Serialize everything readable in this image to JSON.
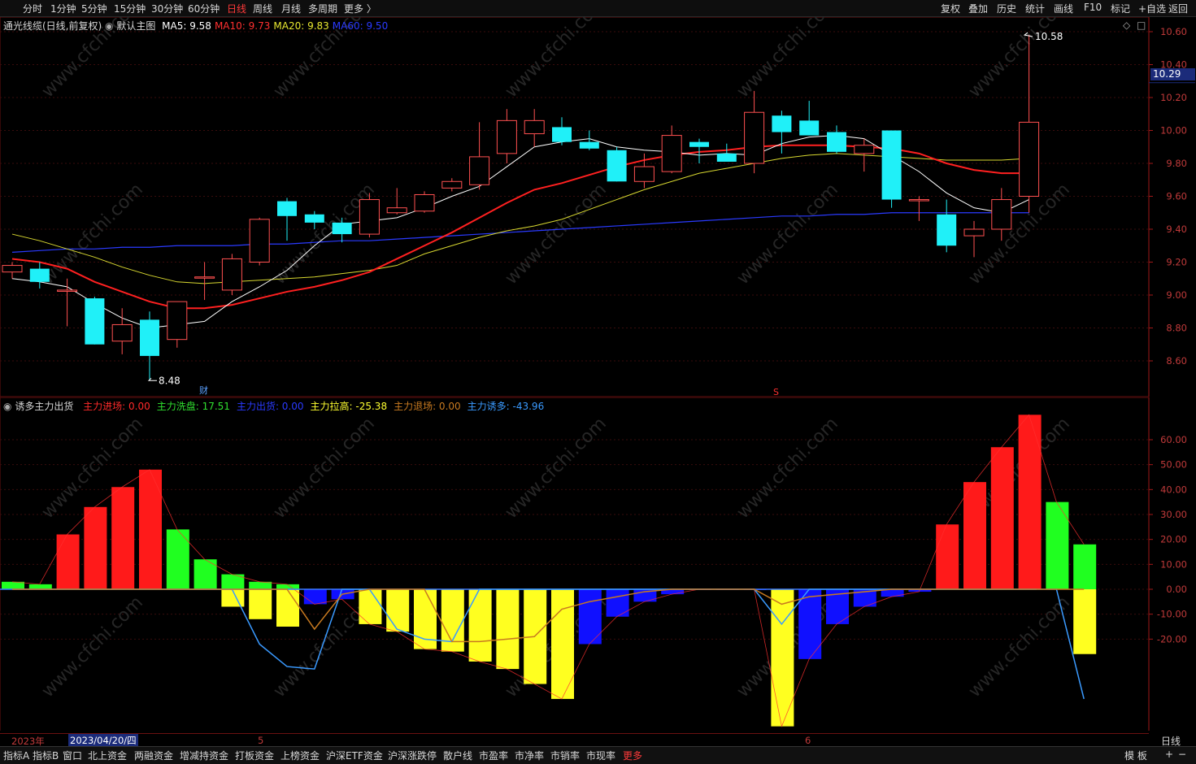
{
  "toolbar": {
    "periods": [
      "分时",
      "1分钟",
      "5分钟",
      "15分钟",
      "30分钟",
      "60分钟",
      "日线",
      "周线",
      "月线",
      "多周期",
      "更多 〉"
    ],
    "active_period": "日线",
    "right_tools": [
      "复权",
      "叠加",
      "历史",
      "统计",
      "画线",
      "F10",
      "标记",
      "+自选",
      "返回"
    ]
  },
  "main": {
    "stock_name": "通光线缆(日线,前复权)",
    "chart_mode": "默认主图",
    "ma": [
      {
        "label": "MA5: 9.58",
        "color": "#ffffff"
      },
      {
        "label": "MA10: 9.73",
        "color": "#ff3030"
      },
      {
        "label": "MA20: 9.83",
        "color": "#e8e830"
      },
      {
        "label": "MA60: 9.50",
        "color": "#2a3aff"
      }
    ],
    "high_label": "10.58",
    "low_label": "8.48",
    "current_price": "10.29",
    "marker_cai": "财",
    "marker_s": "S"
  },
  "indicator": {
    "name": "诱多主力出货",
    "items": [
      {
        "label": "主力进场: 0.00",
        "color": "#ff2a2a"
      },
      {
        "label": "主力洗盘: 17.51",
        "color": "#30e030"
      },
      {
        "label": "主力出货: 0.00",
        "color": "#2a3aff"
      },
      {
        "label": "主力拉高: -25.38",
        "color": "#ffff30"
      },
      {
        "label": "主力退场: 0.00",
        "color": "#c87a20"
      },
      {
        "label": "主力诱多: -43.96",
        "color": "#3a9aff"
      }
    ]
  },
  "price_axis": [
    "10.60",
    "10.40",
    "10.20",
    "10.00",
    "9.80",
    "9.60",
    "9.40",
    "9.20",
    "9.00",
    "8.80",
    "8.60"
  ],
  "ind_axis": [
    "60.00",
    "50.00",
    "40.00",
    "30.00",
    "20.00",
    "10.00",
    "0.00",
    "-10.00",
    "-20.00"
  ],
  "date_axis": {
    "year": "2023年",
    "cursor_date": "2023/04/20/四",
    "months": [
      "5",
      "6"
    ],
    "period": "日线"
  },
  "watermark": "www.cfchi.com",
  "bottom_tabs": [
    "指标A",
    "指标B",
    "窗口",
    "北上资金",
    "两融资金",
    "增减持资金",
    "打板资金",
    "上榜资金",
    "沪深ETF资金",
    "沪深涨跌停",
    "散户线",
    "市盈率",
    "市净率",
    "市销率",
    "市现率",
    "更多"
  ],
  "bottom_right": [
    "模 板",
    "+",
    "−"
  ],
  "chart_data": {
    "type": "candlestick",
    "price_range": [
      8.48,
      10.66
    ],
    "candles": [
      {
        "o": 9.14,
        "h": 9.2,
        "l": 9.1,
        "c": 9.18
      },
      {
        "o": 9.16,
        "h": 9.2,
        "l": 9.04,
        "c": 9.08
      },
      {
        "o": 9.03,
        "h": 9.1,
        "l": 8.81,
        "c": 9.03
      },
      {
        "o": 8.98,
        "h": 8.99,
        "l": 8.7,
        "c": 8.7
      },
      {
        "o": 8.72,
        "h": 8.92,
        "l": 8.64,
        "c": 8.82
      },
      {
        "o": 8.85,
        "h": 8.9,
        "l": 8.48,
        "c": 8.63
      },
      {
        "o": 8.73,
        "h": 8.96,
        "l": 8.68,
        "c": 8.96
      },
      {
        "o": 9.11,
        "h": 9.2,
        "l": 8.97,
        "c": 9.11
      },
      {
        "o": 9.03,
        "h": 9.25,
        "l": 9.0,
        "c": 9.22
      },
      {
        "o": 9.2,
        "h": 9.47,
        "l": 9.18,
        "c": 9.46
      },
      {
        "o": 9.57,
        "h": 9.59,
        "l": 9.33,
        "c": 9.48
      },
      {
        "o": 9.49,
        "h": 9.51,
        "l": 9.4,
        "c": 9.44
      },
      {
        "o": 9.44,
        "h": 9.47,
        "l": 9.32,
        "c": 9.37
      },
      {
        "o": 9.37,
        "h": 9.62,
        "l": 9.35,
        "c": 9.58
      },
      {
        "o": 9.5,
        "h": 9.65,
        "l": 9.49,
        "c": 9.53
      },
      {
        "o": 9.51,
        "h": 9.63,
        "l": 9.5,
        "c": 9.61
      },
      {
        "o": 9.65,
        "h": 9.71,
        "l": 9.63,
        "c": 9.69
      },
      {
        "o": 9.67,
        "h": 10.05,
        "l": 9.64,
        "c": 9.84
      },
      {
        "o": 9.86,
        "h": 10.13,
        "l": 9.8,
        "c": 10.06
      },
      {
        "o": 9.98,
        "h": 10.13,
        "l": 9.9,
        "c": 10.06
      },
      {
        "o": 10.02,
        "h": 10.08,
        "l": 9.91,
        "c": 9.93
      },
      {
        "o": 9.93,
        "h": 10.0,
        "l": 9.88,
        "c": 9.89
      },
      {
        "o": 9.88,
        "h": 9.9,
        "l": 9.69,
        "c": 9.69
      },
      {
        "o": 9.69,
        "h": 9.86,
        "l": 9.65,
        "c": 9.78
      },
      {
        "o": 9.75,
        "h": 10.03,
        "l": 9.74,
        "c": 9.97
      },
      {
        "o": 9.93,
        "h": 9.95,
        "l": 9.8,
        "c": 9.9
      },
      {
        "o": 9.86,
        "h": 9.92,
        "l": 9.82,
        "c": 9.81
      },
      {
        "o": 9.8,
        "h": 10.24,
        "l": 9.74,
        "c": 10.11
      },
      {
        "o": 10.09,
        "h": 10.12,
        "l": 9.86,
        "c": 9.99
      },
      {
        "o": 10.06,
        "h": 10.18,
        "l": 9.97,
        "c": 9.97
      },
      {
        "o": 9.99,
        "h": 10.03,
        "l": 9.86,
        "c": 9.87
      },
      {
        "o": 9.86,
        "h": 9.95,
        "l": 9.75,
        "c": 9.91
      },
      {
        "o": 10.0,
        "h": 10.0,
        "l": 9.53,
        "c": 9.58
      },
      {
        "o": 9.58,
        "h": 9.6,
        "l": 9.45,
        "c": 9.58
      },
      {
        "o": 9.49,
        "h": 9.58,
        "l": 9.26,
        "c": 9.3
      },
      {
        "o": 9.36,
        "h": 9.45,
        "l": 9.23,
        "c": 9.4
      },
      {
        "o": 9.4,
        "h": 9.65,
        "l": 9.33,
        "c": 9.58
      },
      {
        "o": 9.6,
        "h": 10.58,
        "l": 9.5,
        "c": 10.05
      }
    ],
    "ma_lines": {
      "MA5": [
        9.1,
        9.08,
        9.05,
        8.95,
        8.86,
        8.8,
        8.82,
        8.84,
        8.96,
        9.05,
        9.15,
        9.3,
        9.43,
        9.45,
        9.47,
        9.53,
        9.6,
        9.66,
        9.78,
        9.9,
        9.93,
        9.95,
        9.9,
        9.88,
        9.87,
        9.85,
        9.86,
        9.85,
        9.92,
        9.96,
        9.97,
        9.95,
        9.85,
        9.75,
        9.62,
        9.53,
        9.5,
        9.58
      ],
      "MA10": [
        9.22,
        9.2,
        9.16,
        9.08,
        9.02,
        8.96,
        8.92,
        8.92,
        8.94,
        8.98,
        9.02,
        9.05,
        9.09,
        9.14,
        9.22,
        9.3,
        9.38,
        9.47,
        9.56,
        9.64,
        9.68,
        9.73,
        9.78,
        9.82,
        9.85,
        9.87,
        9.88,
        9.9,
        9.91,
        9.91,
        9.91,
        9.9,
        9.89,
        9.86,
        9.8,
        9.76,
        9.74,
        9.74
      ],
      "MA20": [
        9.37,
        9.33,
        9.28,
        9.23,
        9.17,
        9.12,
        9.08,
        9.07,
        9.08,
        9.09,
        9.1,
        9.11,
        9.13,
        9.15,
        9.18,
        9.25,
        9.3,
        9.35,
        9.39,
        9.42,
        9.46,
        9.52,
        9.58,
        9.64,
        9.69,
        9.74,
        9.77,
        9.8,
        9.83,
        9.85,
        9.86,
        9.85,
        9.84,
        9.83,
        9.82,
        9.82,
        9.82,
        9.83
      ],
      "MA60": [
        9.26,
        9.27,
        9.28,
        9.28,
        9.29,
        9.29,
        9.3,
        9.3,
        9.3,
        9.31,
        9.31,
        9.32,
        9.33,
        9.33,
        9.34,
        9.35,
        9.36,
        9.37,
        9.38,
        9.39,
        9.4,
        9.41,
        9.42,
        9.43,
        9.44,
        9.45,
        9.46,
        9.47,
        9.48,
        9.48,
        9.49,
        9.49,
        9.5,
        9.5,
        9.5,
        9.5,
        9.5,
        9.5
      ]
    },
    "indicator_range": [
      -56,
      70
    ],
    "bars": [
      3,
      2,
      22,
      33,
      41,
      48,
      24,
      12,
      6,
      3,
      2,
      -6,
      -4,
      -14,
      -17,
      -24,
      -25,
      -29,
      -32,
      -38,
      -44,
      -22,
      -11,
      -5,
      -2,
      0,
      0,
      0,
      -55,
      -28,
      -14,
      -7,
      -3,
      -1,
      26,
      43,
      57,
      70,
      35,
      18
    ],
    "bar_colors": [
      "g",
      "g",
      "r",
      "r",
      "r",
      "r",
      "g",
      "g",
      "g",
      "g",
      "g",
      "b",
      "b",
      "y",
      "y",
      "y",
      "y",
      "y",
      "y",
      "y",
      "y",
      "b",
      "b",
      "b",
      "b",
      "b",
      "b",
      "b",
      "y",
      "b",
      "b",
      "b",
      "b",
      "b",
      "r",
      "r",
      "r",
      "r",
      "g",
      "g"
    ],
    "second_bars": [
      0,
      0,
      0,
      0,
      0,
      0,
      0,
      0,
      -7,
      -12,
      -15,
      0,
      0,
      0,
      0,
      0,
      0,
      0,
      0,
      0,
      0,
      0,
      0,
      0,
      0,
      0,
      0,
      0,
      0,
      0,
      0,
      0,
      0,
      0,
      0,
      0,
      0,
      0,
      0,
      -26
    ],
    "lines": {
      "主力诱多": [
        0,
        0,
        0,
        0,
        0,
        0,
        0,
        0,
        0,
        -22,
        -31,
        -32,
        0,
        0,
        -16,
        -20,
        -21,
        0,
        0,
        0,
        0,
        0,
        0,
        0,
        0,
        0,
        0,
        0,
        -14,
        0,
        0,
        0,
        0,
        0,
        0,
        0,
        0,
        0,
        0,
        -44
      ],
      "主力退场": [
        0,
        0,
        0,
        0,
        0,
        0,
        0,
        0,
        0,
        0,
        0,
        -16,
        -2,
        0,
        0,
        0,
        -21,
        -21,
        -20,
        -19,
        -8,
        -5,
        -3,
        -1,
        0,
        0,
        0,
        0,
        -6,
        -3,
        -2,
        -1,
        0,
        0,
        0,
        0,
        0,
        0,
        0,
        0
      ]
    }
  }
}
